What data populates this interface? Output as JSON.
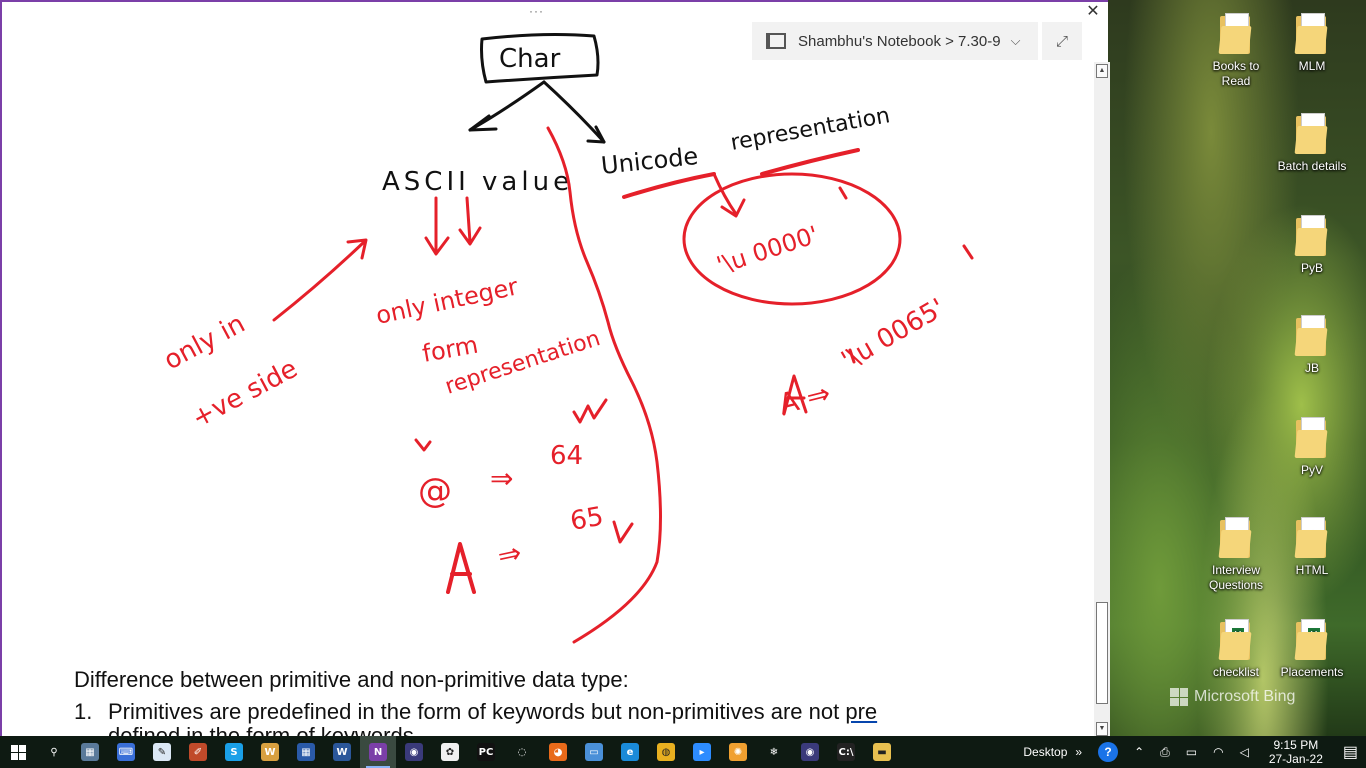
{
  "window": {
    "titlebar_dots": "···",
    "close": "✕",
    "breadcrumb": "Shambhu's Notebook > 7.30-9",
    "chevron": "⌵",
    "expand": "⤢"
  },
  "ink": {
    "color_red": "#e5202a",
    "color_black": "#111111",
    "char_label": "Char",
    "ascii_label": "ASCII value",
    "unicode_label": "Unicode",
    "representation_label": "representation",
    "only_integer": "only integer",
    "form": "form",
    "representation2": "representation",
    "only_in": "only in",
    "ve_side": "+ve side",
    "unicode_default": "'\\u 0000'",
    "unicode_a": "'\\u 0065'",
    "a_arrow": "A ⇒",
    "at_sign": "@",
    "at_value": "64",
    "a_letter": "A",
    "a_value": "65",
    "double_arrow": "⇒"
  },
  "note": {
    "heading": "Difference between primitive and non-primitive data type:",
    "item1_num": "1.",
    "item1_text": "Primitives are predefined in the form of keywords but non-primitives are not ",
    "item1_link": "pre",
    "item1_cont": "defined in the form of keywords"
  },
  "desktop": {
    "icons": [
      {
        "label": "Books to Read",
        "type": "pdf"
      },
      {
        "label": "MLM",
        "type": "folder"
      },
      {
        "label": "Batch details",
        "type": "folder"
      },
      {
        "label": "PyB",
        "type": "pdf"
      },
      {
        "label": "JB",
        "type": "pdf"
      },
      {
        "label": "PyV",
        "type": "pdf"
      },
      {
        "label": "Interview Questions",
        "type": "pdf"
      },
      {
        "label": "HTML",
        "type": "html"
      },
      {
        "label": "checklist",
        "type": "xls"
      },
      {
        "label": "Placements",
        "type": "xls"
      }
    ],
    "watermark": "Microsoft Bing"
  },
  "taskbar": {
    "desktop_label": "Desktop",
    "time": "9:15 PM",
    "date": "27-Jan-22",
    "help": "?",
    "chevrons": "»",
    "apps": [
      {
        "name": "search-icon",
        "glyph": "⚲",
        "color": "#0e1a12"
      },
      {
        "name": "calculator-icon",
        "glyph": "▦",
        "color": "#5a7a9a"
      },
      {
        "name": "keyboard-icon",
        "glyph": "⌨",
        "color": "#3a6fd8"
      },
      {
        "name": "notepad-icon",
        "glyph": "✎",
        "color": "#dbe8f5"
      },
      {
        "name": "pen-icon",
        "glyph": "✐",
        "color": "#c04a2a"
      },
      {
        "name": "skype-icon",
        "glyph": "S",
        "color": "#1aa0e8"
      },
      {
        "name": "wordpad-icon",
        "glyph": "W",
        "color": "#d8a040"
      },
      {
        "name": "calendar-icon",
        "glyph": "▦",
        "color": "#2a5aa8"
      },
      {
        "name": "word-icon",
        "glyph": "W",
        "color": "#2b579a"
      },
      {
        "name": "onenote-icon",
        "glyph": "N",
        "color": "#7b3fa8"
      },
      {
        "name": "eclipse-icon",
        "glyph": "◉",
        "color": "#3a3a7a"
      },
      {
        "name": "paint-icon",
        "glyph": "✿",
        "color": "#f0f0f0"
      },
      {
        "name": "pycharm-icon",
        "glyph": "PC",
        "color": "#111111"
      },
      {
        "name": "circle-app-icon",
        "glyph": "◌",
        "color": "#0e1a12"
      },
      {
        "name": "firefox-icon",
        "glyph": "◕",
        "color": "#e86a1a"
      },
      {
        "name": "monitor-icon",
        "glyph": "▭",
        "color": "#4a90d8"
      },
      {
        "name": "edge-icon",
        "glyph": "e",
        "color": "#1a8ad8"
      },
      {
        "name": "chrome-icon",
        "glyph": "◍",
        "color": "#e8b020"
      },
      {
        "name": "zoom-icon",
        "glyph": "▸",
        "color": "#2d8cff"
      },
      {
        "name": "orange-app-icon",
        "glyph": "✺",
        "color": "#f0a030"
      },
      {
        "name": "snowflake-icon",
        "glyph": "❄",
        "color": "#0e1a12"
      },
      {
        "name": "eclipse2-icon",
        "glyph": "◉",
        "color": "#3a3a7a"
      },
      {
        "name": "cmd-icon",
        "glyph": "C:\\",
        "color": "#222222"
      },
      {
        "name": "explorer-icon",
        "glyph": "▬",
        "color": "#e8c050"
      }
    ]
  }
}
